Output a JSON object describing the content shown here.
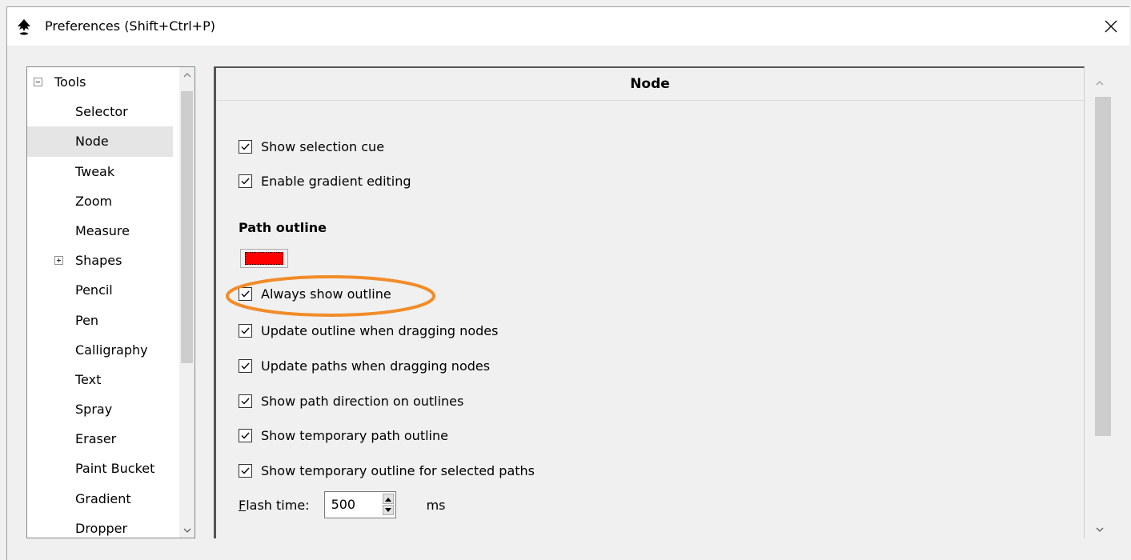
{
  "window": {
    "title": "Preferences (Shift+Ctrl+P)",
    "app_icon": "inkscape-logo-icon",
    "close_icon": "close-icon"
  },
  "tree": {
    "items": [
      {
        "label": "Tools",
        "expander": "minus",
        "selected": false
      },
      {
        "label": "Selector",
        "selected": false
      },
      {
        "label": "Node",
        "selected": true
      },
      {
        "label": "Tweak",
        "selected": false
      },
      {
        "label": "Zoom",
        "selected": false
      },
      {
        "label": "Measure",
        "selected": false
      },
      {
        "label": "Shapes",
        "expander": "plus",
        "selected": false
      },
      {
        "label": "Pencil",
        "selected": false
      },
      {
        "label": "Pen",
        "selected": false
      },
      {
        "label": "Calligraphy",
        "selected": false
      },
      {
        "label": "Text",
        "selected": false
      },
      {
        "label": "Spray",
        "selected": false
      },
      {
        "label": "Eraser",
        "selected": false
      },
      {
        "label": "Paint Bucket",
        "selected": false
      },
      {
        "label": "Gradient",
        "selected": false
      },
      {
        "label": "Dropper",
        "selected": false
      }
    ]
  },
  "pane": {
    "header": "Node",
    "show_selection_cue": {
      "label": "Show selection cue",
      "checked": true
    },
    "enable_gradient_editing": {
      "label": "Enable gradient editing",
      "checked": true
    },
    "path_outline_title": "Path outline",
    "path_outline_color": "#ff0000",
    "always_show_outline": {
      "label": "Always show outline",
      "checked": true
    },
    "update_outline_dragging": {
      "label": "Update outline when dragging nodes",
      "checked": true
    },
    "update_paths_dragging": {
      "label": "Update paths when dragging nodes",
      "checked": true
    },
    "show_path_direction": {
      "label": "Show path direction on outlines",
      "checked": true
    },
    "show_temp_path_outline": {
      "label": "Show temporary path outline",
      "checked": true
    },
    "show_temp_outline_selected": {
      "label": "Show temporary outline for selected paths",
      "checked": true
    },
    "flash_time": {
      "label_mnemonic": "F",
      "label_rest": "lash time:",
      "value": "500",
      "unit": "ms"
    }
  },
  "colors": {
    "highlight_ellipse": "#f28c28",
    "checkmark": "#000000"
  }
}
